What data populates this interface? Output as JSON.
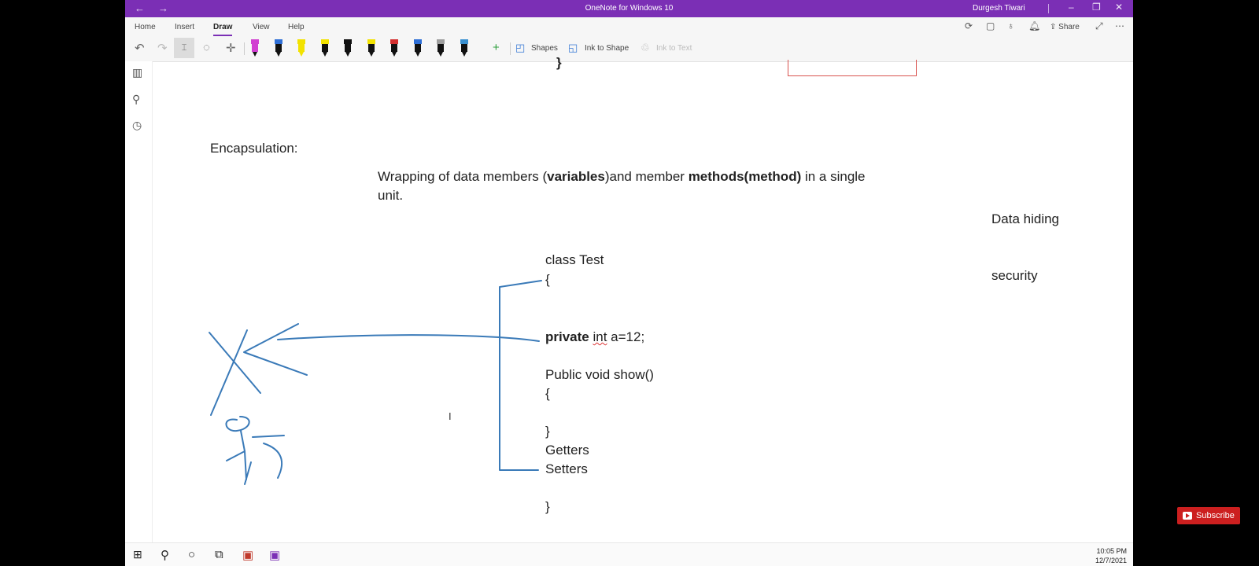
{
  "titlebar": {
    "back_icon": "back-arrow-icon",
    "forward_icon": "forward-arrow-icon",
    "title": "OneNote for Windows 10",
    "user": "Durgesh Tiwari"
  },
  "ribbon": {
    "tabs": [
      "Home",
      "Insert",
      "Draw",
      "View",
      "Help"
    ],
    "active_tab": "Draw",
    "share_label": "Share"
  },
  "toolbar": {
    "pens": [
      {
        "color": "#111111",
        "cap": "#d13fd1"
      },
      {
        "color": "#111111",
        "cap": "#2f6fd6"
      },
      {
        "color": "#f2e200",
        "cap": "#f2e200"
      },
      {
        "color": "#111111",
        "cap": "#f2e200"
      },
      {
        "color": "#111111",
        "cap": "#111111"
      },
      {
        "color": "#111111",
        "cap": "#f2e200"
      },
      {
        "color": "#111111",
        "cap": "#d32f2f"
      },
      {
        "color": "#111111",
        "cap": "#2f6fd6"
      },
      {
        "color": "#111111",
        "cap": "#9e9e9e"
      },
      {
        "color": "#111111",
        "cap": "#3a90d0"
      }
    ],
    "shapes_label": "Shapes",
    "ink_to_shape_label": "Ink to Shape",
    "ink_to_text_label": "Ink to Text"
  },
  "note": {
    "top_brace": "}",
    "heading": "Encapsulation:",
    "definition_parts": [
      "Wrapping of data members (",
      "variables",
      ")and member ",
      "methods(method)",
      " in a single"
    ],
    "definition_line2": "unit.",
    "side_notes": [
      "Data hiding",
      "security"
    ],
    "code": {
      "class_decl": "class  Test",
      "open_brace": "{",
      "private_kw": "private",
      "int_kw": "int",
      "field_rest": " a=12;",
      "method_decl": "Public void show()",
      "method_open": "{",
      "method_close": "}",
      "getters": "Getters",
      "setters": "Setters",
      "close_brace": "}"
    },
    "ink_color": "#3a7ab8",
    "box_color": "#d9534f"
  },
  "taskbar": {
    "time": "10:05 PM",
    "date": "12/7/2021"
  },
  "overlay": {
    "subscribe_label": "Subscribe"
  }
}
